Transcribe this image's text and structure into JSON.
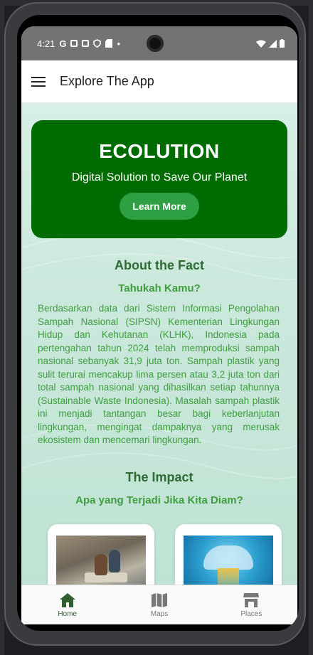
{
  "status": {
    "time": "4:21",
    "icons": [
      "google-icon",
      "screenshot-icon",
      "cast-icon",
      "shield-icon",
      "sim-icon",
      "dot-icon"
    ],
    "right_icons": [
      "wifi-icon",
      "signal-icon",
      "battery-icon"
    ]
  },
  "appbar": {
    "title": "Explore The App"
  },
  "hero": {
    "title": "ECOLUTION",
    "subtitle": "Digital Solution to Save Our Planet",
    "button": "Learn More"
  },
  "fact": {
    "title": "About the Fact",
    "subtitle": "Tahukah Kamu?",
    "body": "Berdasarkan data dari Sistem Informasi Pengolahan Sampah Nasional (SIPSN) Kementerian Lingkungan Hidup dan Kehutanan (KLHK), Indonesia pada pertengahan tahun 2024 telah memproduksi sampah nasional sebanyak 31,9 juta ton. Sampah plastik yang sulit terurai mencakup lima persen atau 3,2 juta ton dari total sampah nasional yang dihasilkan setiap tahunnya (Sustainable Waste Indonesia). Masalah sampah plastik ini menjadi tantangan besar bagi keberlanjutan lingkungan, mengingat dampaknya yang merusak ekosistem dan mencemari lingkungan."
  },
  "impact": {
    "title": "The Impact",
    "subtitle": "Apa yang Terjadi Jika Kita Diam?"
  },
  "nav": [
    {
      "label": "Home",
      "icon": "home-icon",
      "active": true
    },
    {
      "label": "Maps",
      "icon": "map-icon",
      "active": false
    },
    {
      "label": "Places",
      "icon": "store-icon",
      "active": false
    }
  ],
  "colors": {
    "hero_bg": "#006b00",
    "button": "#2ea043",
    "title_green": "#2f6b34",
    "text_green": "#3f9d3f"
  }
}
